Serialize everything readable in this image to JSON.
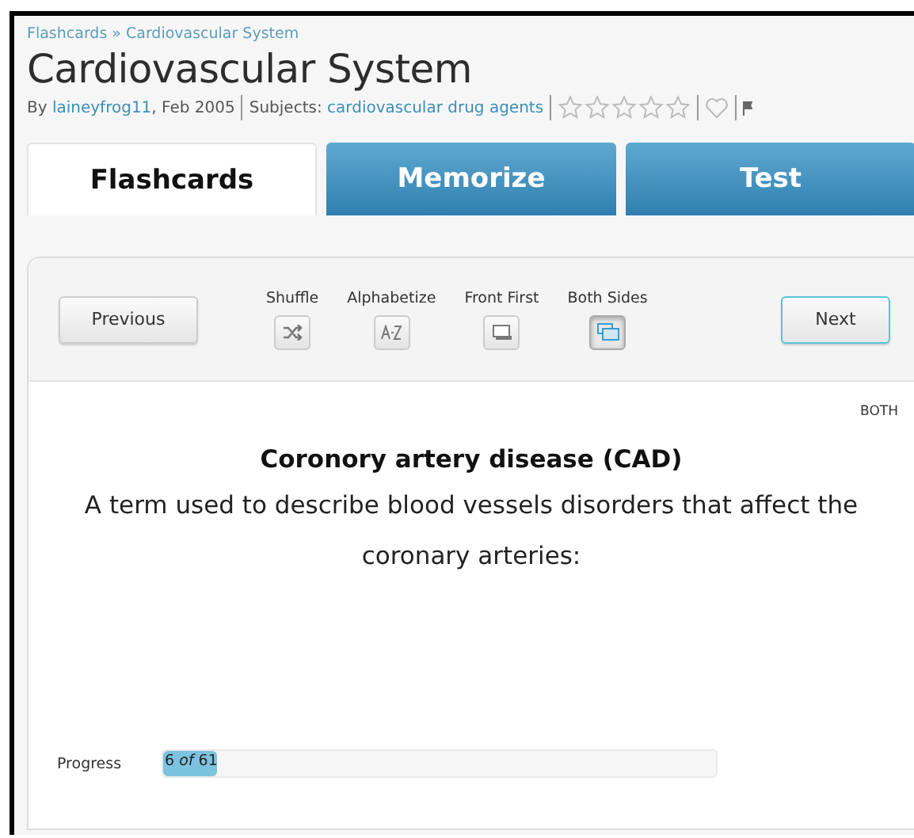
{
  "breadcrumb": {
    "items": [
      "Flashcards",
      "Cardiovascular System"
    ],
    "separator": "»"
  },
  "title": "Cardiovascular System",
  "meta": {
    "by": "By",
    "author": "laineyfrog11",
    "date": ", Feb 2005",
    "subjects_label": "Subjects:",
    "subject": "cardiovascular drug agents",
    "stars": 0
  },
  "tabs": [
    {
      "label": "Flashcards",
      "selected": true
    },
    {
      "label": "Memorize",
      "selected": false
    },
    {
      "label": "Test",
      "selected": false
    }
  ],
  "toolbar": {
    "previous": "Previous",
    "next": "Next",
    "options": [
      {
        "label": "Shuffle",
        "kind": "shuffle",
        "selected": false
      },
      {
        "label": "Alphabetize",
        "kind": "alpha",
        "selected": false
      },
      {
        "label": "Front First",
        "kind": "front",
        "selected": false
      },
      {
        "label": "Both Sides",
        "kind": "both",
        "selected": true
      }
    ]
  },
  "card": {
    "side": "BOTH",
    "term": "Coronory artery disease (CAD)",
    "definition": "A term used to describe blood vessels disorders that affect the coronary arteries:"
  },
  "progress": {
    "label": "Progress",
    "reading": "6 *of* 61",
    "level": 0.098
  }
}
